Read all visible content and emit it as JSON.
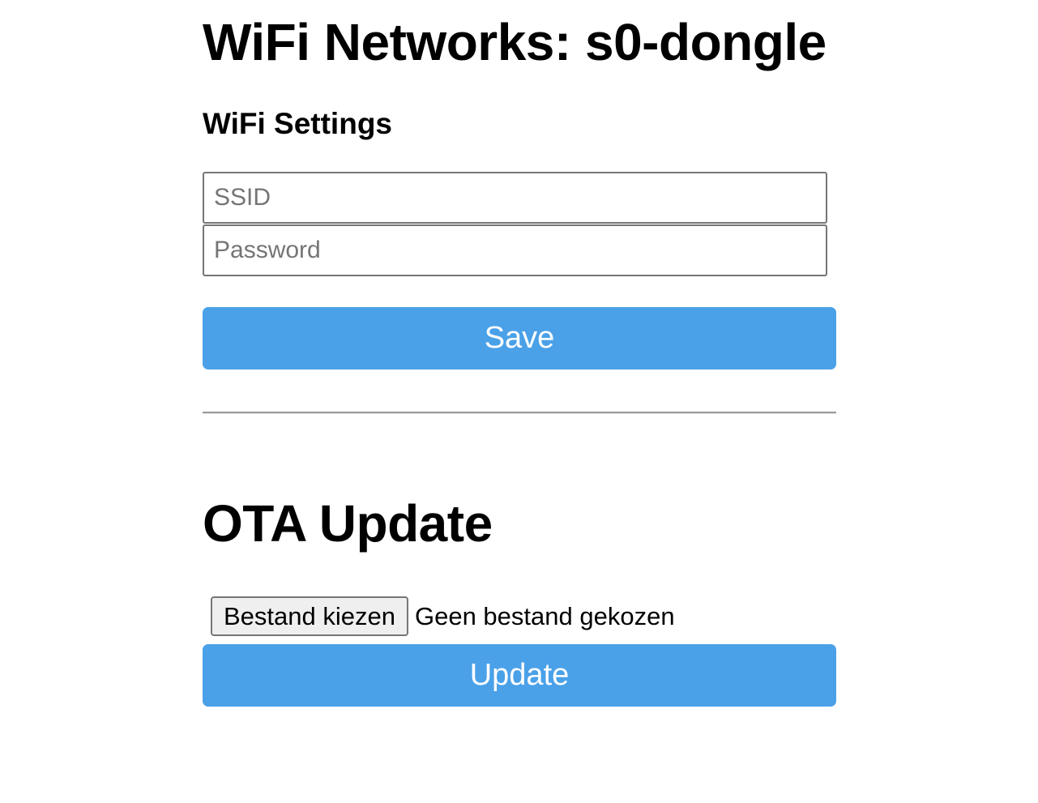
{
  "header": {
    "title": "WiFi Networks: s0-dongle"
  },
  "wifi_settings": {
    "title": "WiFi Settings",
    "ssid_placeholder": "SSID",
    "ssid_value": "",
    "password_placeholder": "Password",
    "password_value": "",
    "save_label": "Save"
  },
  "ota_update": {
    "title": "OTA Update",
    "choose_file_label": "Bestand kiezen",
    "file_status": "Geen bestand gekozen",
    "update_label": "Update"
  },
  "colors": {
    "button_accent": "#4aa1e8",
    "button_text": "#ffffff"
  }
}
